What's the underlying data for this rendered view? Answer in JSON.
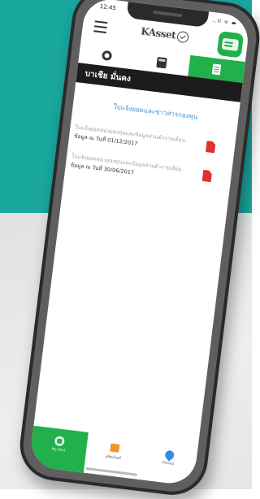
{
  "status": {
    "time": "12:45",
    "icons": "..ll ᯤ ▬"
  },
  "appbar": {
    "logo_text": "KAsset"
  },
  "page_title": "บาเชีย มั่นคง",
  "section_title": "ใบแจ้งยอดและข่าวสารกองทุน",
  "documents": [
    {
      "title": "ใบแจ้งยอดหน่วยลงทุนและข้อมูลส่วนตัวรายเดือน",
      "date": "ข้อมูล ณ วันที่ 01/12/2017"
    },
    {
      "title": "ใบแจ้งยอดหน่วยลงทุนและข้อมูลส่วนตัวรายเดือน",
      "date": "ข้อมูล ณ วันที่ 30/06/2017"
    }
  ],
  "bottom_nav": [
    {
      "label": "My Port"
    },
    {
      "label": "ผลิตภัณฑ์"
    },
    {
      "label": "Promo"
    }
  ],
  "colors": {
    "teal": "#1aa79e",
    "green": "#21b04b",
    "title_bar": "#1c1c1c",
    "link_blue": "#3b8fd6",
    "pdf_red": "#e22f2f"
  }
}
